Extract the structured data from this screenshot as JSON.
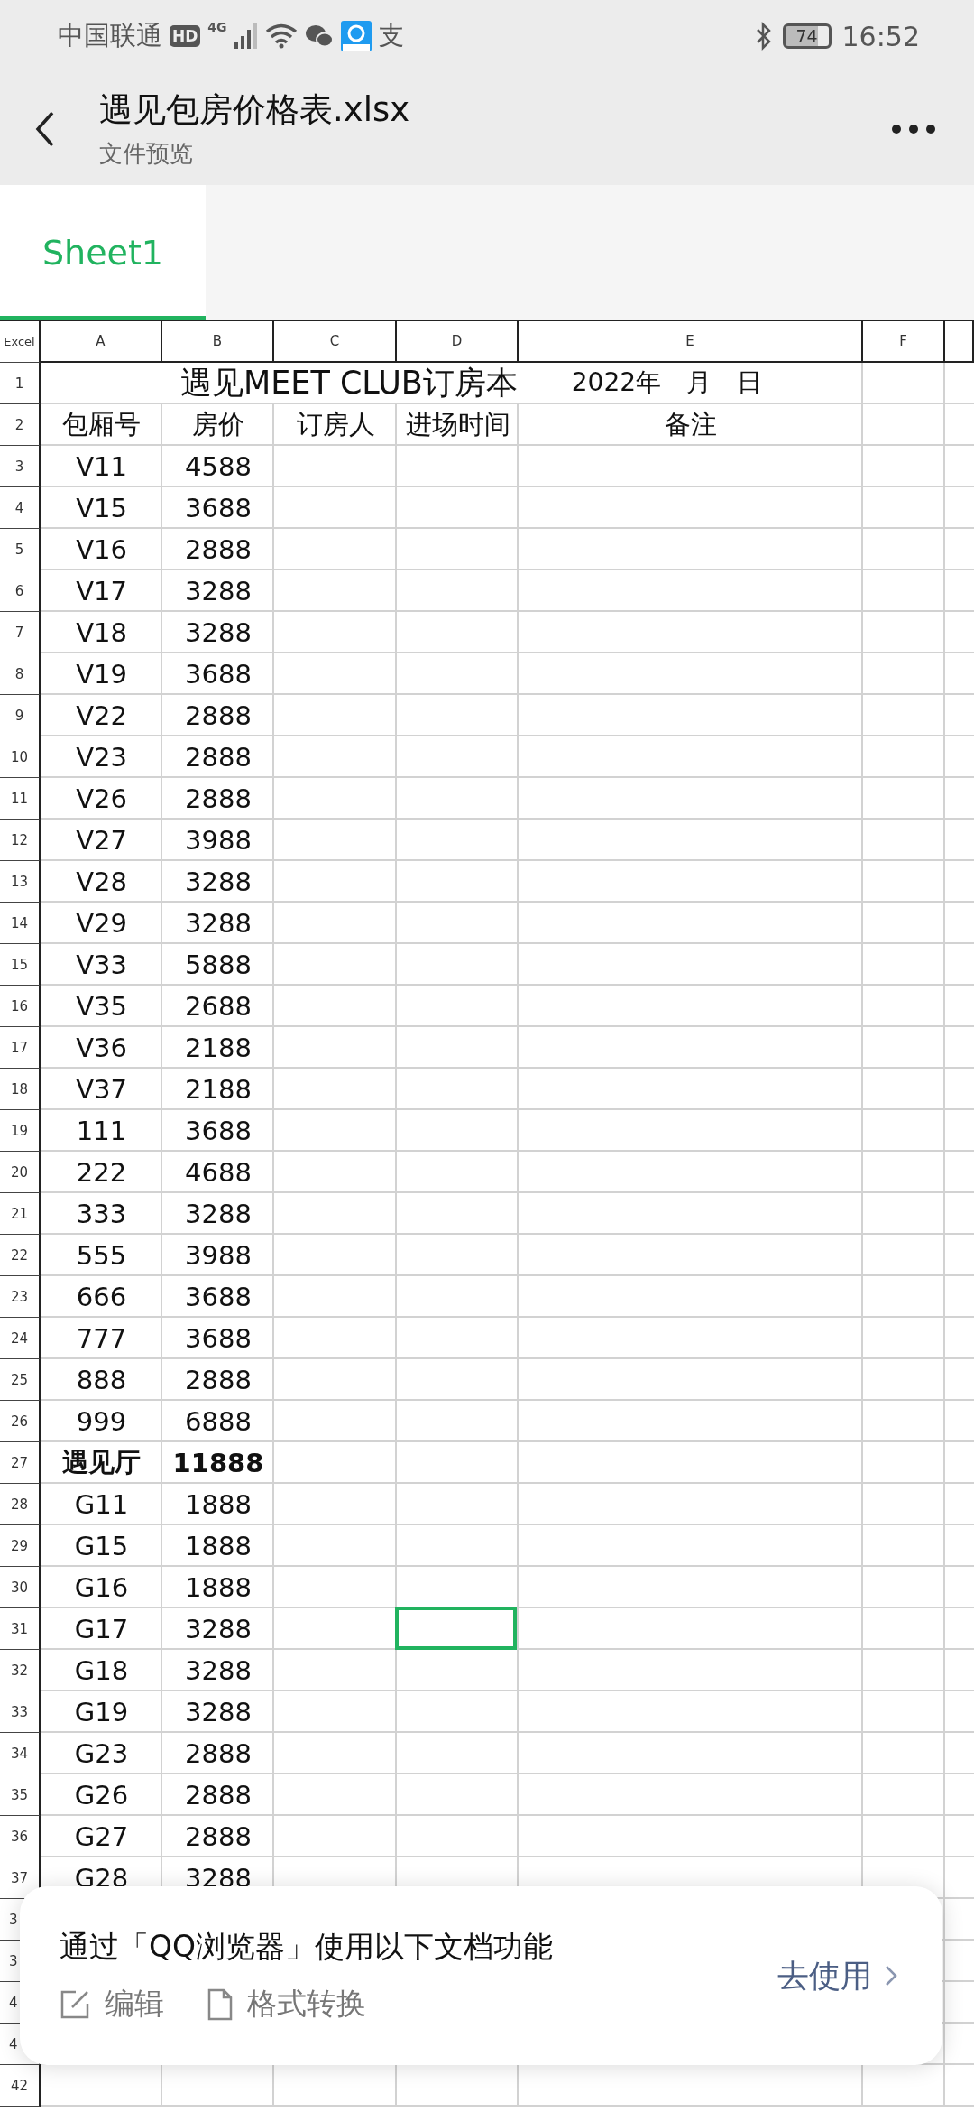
{
  "status_bar": {
    "carrier": "中国联通",
    "hd_badge": "HD",
    "network": "4G",
    "alipay_glyph": "支",
    "battery": "74",
    "time": "16:52"
  },
  "header": {
    "title": "遇见包房价格表.xlsx",
    "subtitle": "文件预览"
  },
  "tabs": [
    {
      "label": "Sheet1",
      "selected": true
    }
  ],
  "sheet": {
    "corner": "Excel",
    "columns": [
      "A",
      "B",
      "C",
      "D",
      "E",
      "F"
    ],
    "title_row": {
      "number": "1",
      "title": "遇见MEET CLUB订房本",
      "date": "2022年　月　日"
    },
    "header_row": {
      "number": "2",
      "labels": [
        "包厢号",
        "房价",
        "订房人",
        "进场时间",
        "备注"
      ]
    },
    "rows": [
      {
        "number": "3",
        "room": "V11",
        "price": "4588",
        "bold": false,
        "blank_cells": [
          {
            "selected": false
          },
          {
            "selected": false
          },
          {
            "selected": false
          },
          {
            "selected": false
          }
        ]
      },
      {
        "number": "4",
        "room": "V15",
        "price": "3688",
        "bold": false,
        "blank_cells": [
          {
            "selected": false
          },
          {
            "selected": false
          },
          {
            "selected": false
          },
          {
            "selected": false
          }
        ]
      },
      {
        "number": "5",
        "room": "V16",
        "price": "2888",
        "bold": false,
        "blank_cells": [
          {
            "selected": false
          },
          {
            "selected": false
          },
          {
            "selected": false
          },
          {
            "selected": false
          }
        ]
      },
      {
        "number": "6",
        "room": "V17",
        "price": "3288",
        "bold": false,
        "blank_cells": [
          {
            "selected": false
          },
          {
            "selected": false
          },
          {
            "selected": false
          },
          {
            "selected": false
          }
        ]
      },
      {
        "number": "7",
        "room": "V18",
        "price": "3288",
        "bold": false,
        "blank_cells": [
          {
            "selected": false
          },
          {
            "selected": false
          },
          {
            "selected": false
          },
          {
            "selected": false
          }
        ]
      },
      {
        "number": "8",
        "room": "V19",
        "price": "3688",
        "bold": false,
        "blank_cells": [
          {
            "selected": false
          },
          {
            "selected": false
          },
          {
            "selected": false
          },
          {
            "selected": false
          }
        ]
      },
      {
        "number": "9",
        "room": "V22",
        "price": "2888",
        "bold": false,
        "blank_cells": [
          {
            "selected": false
          },
          {
            "selected": false
          },
          {
            "selected": false
          },
          {
            "selected": false
          }
        ]
      },
      {
        "number": "10",
        "room": "V23",
        "price": "2888",
        "bold": false,
        "blank_cells": [
          {
            "selected": false
          },
          {
            "selected": false
          },
          {
            "selected": false
          },
          {
            "selected": false
          }
        ]
      },
      {
        "number": "11",
        "room": "V26",
        "price": "2888",
        "bold": false,
        "blank_cells": [
          {
            "selected": false
          },
          {
            "selected": false
          },
          {
            "selected": false
          },
          {
            "selected": false
          }
        ]
      },
      {
        "number": "12",
        "room": "V27",
        "price": "3988",
        "bold": false,
        "blank_cells": [
          {
            "selected": false
          },
          {
            "selected": false
          },
          {
            "selected": false
          },
          {
            "selected": false
          }
        ]
      },
      {
        "number": "13",
        "room": "V28",
        "price": "3288",
        "bold": false,
        "blank_cells": [
          {
            "selected": false
          },
          {
            "selected": false
          },
          {
            "selected": false
          },
          {
            "selected": false
          }
        ]
      },
      {
        "number": "14",
        "room": "V29",
        "price": "3288",
        "bold": false,
        "blank_cells": [
          {
            "selected": false
          },
          {
            "selected": false
          },
          {
            "selected": false
          },
          {
            "selected": false
          }
        ]
      },
      {
        "number": "15",
        "room": "V33",
        "price": "5888",
        "bold": false,
        "blank_cells": [
          {
            "selected": false
          },
          {
            "selected": false
          },
          {
            "selected": false
          },
          {
            "selected": false
          }
        ]
      },
      {
        "number": "16",
        "room": "V35",
        "price": "2688",
        "bold": false,
        "blank_cells": [
          {
            "selected": false
          },
          {
            "selected": false
          },
          {
            "selected": false
          },
          {
            "selected": false
          }
        ]
      },
      {
        "number": "17",
        "room": "V36",
        "price": "2188",
        "bold": false,
        "blank_cells": [
          {
            "selected": false
          },
          {
            "selected": false
          },
          {
            "selected": false
          },
          {
            "selected": false
          }
        ]
      },
      {
        "number": "18",
        "room": "V37",
        "price": "2188",
        "bold": false,
        "blank_cells": [
          {
            "selected": false
          },
          {
            "selected": false
          },
          {
            "selected": false
          },
          {
            "selected": false
          }
        ]
      },
      {
        "number": "19",
        "room": "111",
        "price": "3688",
        "bold": false,
        "blank_cells": [
          {
            "selected": false
          },
          {
            "selected": false
          },
          {
            "selected": false
          },
          {
            "selected": false
          }
        ]
      },
      {
        "number": "20",
        "room": "222",
        "price": "4688",
        "bold": false,
        "blank_cells": [
          {
            "selected": false
          },
          {
            "selected": false
          },
          {
            "selected": false
          },
          {
            "selected": false
          }
        ]
      },
      {
        "number": "21",
        "room": "333",
        "price": "3288",
        "bold": false,
        "blank_cells": [
          {
            "selected": false
          },
          {
            "selected": false
          },
          {
            "selected": false
          },
          {
            "selected": false
          }
        ]
      },
      {
        "number": "22",
        "room": "555",
        "price": "3988",
        "bold": false,
        "blank_cells": [
          {
            "selected": false
          },
          {
            "selected": false
          },
          {
            "selected": false
          },
          {
            "selected": false
          }
        ]
      },
      {
        "number": "23",
        "room": "666",
        "price": "3688",
        "bold": false,
        "blank_cells": [
          {
            "selected": false
          },
          {
            "selected": false
          },
          {
            "selected": false
          },
          {
            "selected": false
          }
        ]
      },
      {
        "number": "24",
        "room": "777",
        "price": "3688",
        "bold": false,
        "blank_cells": [
          {
            "selected": false
          },
          {
            "selected": false
          },
          {
            "selected": false
          },
          {
            "selected": false
          }
        ]
      },
      {
        "number": "25",
        "room": "888",
        "price": "2888",
        "bold": false,
        "blank_cells": [
          {
            "selected": false
          },
          {
            "selected": false
          },
          {
            "selected": false
          },
          {
            "selected": false
          }
        ]
      },
      {
        "number": "26",
        "room": "999",
        "price": "6888",
        "bold": false,
        "blank_cells": [
          {
            "selected": false
          },
          {
            "selected": false
          },
          {
            "selected": false
          },
          {
            "selected": false
          }
        ]
      },
      {
        "number": "27",
        "room": "遇见厅",
        "price": "11888",
        "bold": true,
        "blank_cells": [
          {
            "selected": false
          },
          {
            "selected": false
          },
          {
            "selected": false
          },
          {
            "selected": false
          }
        ]
      },
      {
        "number": "28",
        "room": "G11",
        "price": "1888",
        "bold": false,
        "blank_cells": [
          {
            "selected": false
          },
          {
            "selected": false
          },
          {
            "selected": false
          },
          {
            "selected": false
          }
        ]
      },
      {
        "number": "29",
        "room": "G15",
        "price": "1888",
        "bold": false,
        "blank_cells": [
          {
            "selected": false
          },
          {
            "selected": false
          },
          {
            "selected": false
          },
          {
            "selected": false
          }
        ]
      },
      {
        "number": "30",
        "room": "G16",
        "price": "1888",
        "bold": false,
        "blank_cells": [
          {
            "selected": false
          },
          {
            "selected": false
          },
          {
            "selected": false
          },
          {
            "selected": false
          }
        ]
      },
      {
        "number": "31",
        "room": "G17",
        "price": "3288",
        "bold": false,
        "blank_cells": [
          {
            "selected": false
          },
          {
            "selected": true
          },
          {
            "selected": false
          },
          {
            "selected": false
          }
        ]
      },
      {
        "number": "32",
        "room": "G18",
        "price": "3288",
        "bold": false,
        "blank_cells": [
          {
            "selected": false
          },
          {
            "selected": false
          },
          {
            "selected": false
          },
          {
            "selected": false
          }
        ]
      },
      {
        "number": "33",
        "room": "G19",
        "price": "3288",
        "bold": false,
        "blank_cells": [
          {
            "selected": false
          },
          {
            "selected": false
          },
          {
            "selected": false
          },
          {
            "selected": false
          }
        ]
      },
      {
        "number": "34",
        "room": "G23",
        "price": "2888",
        "bold": false,
        "blank_cells": [
          {
            "selected": false
          },
          {
            "selected": false
          },
          {
            "selected": false
          },
          {
            "selected": false
          }
        ]
      },
      {
        "number": "35",
        "room": "G26",
        "price": "2888",
        "bold": false,
        "blank_cells": [
          {
            "selected": false
          },
          {
            "selected": false
          },
          {
            "selected": false
          },
          {
            "selected": false
          }
        ]
      },
      {
        "number": "36",
        "room": "G27",
        "price": "2888",
        "bold": false,
        "blank_cells": [
          {
            "selected": false
          },
          {
            "selected": false
          },
          {
            "selected": false
          },
          {
            "selected": false
          }
        ]
      },
      {
        "number": "37",
        "room": "G28",
        "price": "3288",
        "bold": false,
        "blank_cells": [
          {
            "selected": false
          },
          {
            "selected": false
          },
          {
            "selected": false
          },
          {
            "selected": false
          }
        ]
      }
    ],
    "covered_rows": [
      {
        "number": "3"
      },
      {
        "number": "3"
      },
      {
        "number": "4"
      },
      {
        "number": "4"
      }
    ],
    "last_row": {
      "number": "42"
    }
  },
  "popup": {
    "message": "通过「QQ浏览器」使用以下文档功能",
    "features": [
      {
        "kind": "edit",
        "label": "编辑"
      },
      {
        "kind": "convert",
        "label": "格式转换"
      }
    ],
    "action": "去使用"
  }
}
